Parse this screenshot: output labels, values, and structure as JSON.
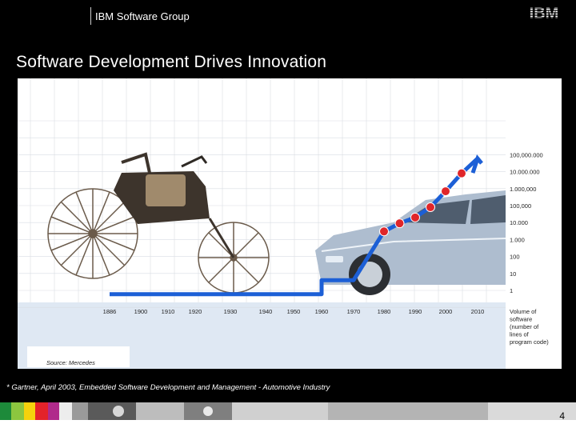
{
  "header": {
    "group": "IBM Software Group",
    "logo": "IBM"
  },
  "slide": {
    "title": "Software Development Drives Innovation",
    "source": "Source: Mercedes",
    "footnote": "* Gartner, April 2003, Embedded Software Development and Management - Automotive Industry",
    "page_number": "4"
  },
  "chart_data": {
    "type": "line",
    "title": "",
    "xlabel": "",
    "ylabel": "Volume of software (number of lines of program code)",
    "ylabel_lines": [
      "Volume of",
      "software",
      "(number of",
      "lines of",
      "program code)"
    ],
    "y_scale": "log",
    "y_ticks": [
      "1",
      "10",
      "100",
      "1.000",
      "10.000",
      "100,000",
      "1.000,000",
      "10.000.000",
      "100,000.000"
    ],
    "x_ticks": [
      "1886",
      "1900",
      "1910",
      "1920",
      "1930",
      "1940",
      "1950",
      "1960",
      "1970",
      "1980",
      "1990",
      "2000",
      "2010"
    ],
    "series": [
      {
        "color": "#1c5fd6",
        "marker_color": "#e0262a",
        "x": [
          1886,
          1960,
          1970,
          1980,
          1985,
          1990,
          1995,
          2000,
          2005,
          2010
        ],
        "y": [
          0.6,
          0.6,
          4,
          3000,
          9000,
          20000,
          80000,
          700000,
          8000000,
          60000000
        ]
      }
    ],
    "grid": true
  },
  "colors": {
    "header_bg": "#000000",
    "panel_bg": "#ffffff",
    "axis_band": "#dfe8f3",
    "line": "#1c5fd6",
    "marker": "#e0262a"
  }
}
